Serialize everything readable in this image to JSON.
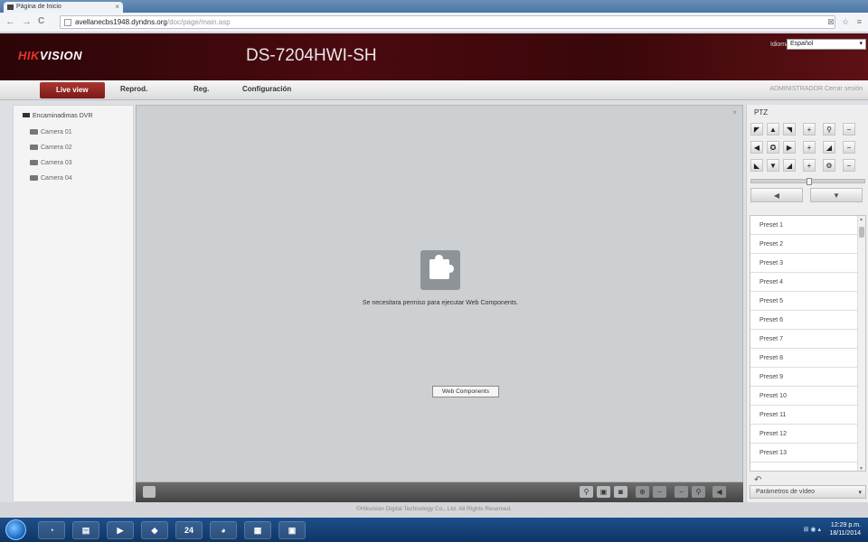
{
  "browser": {
    "tab_title": "Página de Inicio",
    "tab_close": "×",
    "back": "←",
    "forward": "→",
    "reload": "C",
    "url_host": "avellanecbs1948.dyndns.org",
    "url_path": "/doc/page/main.asp",
    "toolbar_right": "⊠ ☆ ≡"
  },
  "header": {
    "logo_prefix": "HIK",
    "logo_suffix": "VISION",
    "device_title": "DS-7204HWI-SH",
    "language_label": "Idioma",
    "language_value": "Español",
    "language_caret": "▾"
  },
  "menu": {
    "items": [
      {
        "label": "Live view",
        "active": true
      },
      {
        "label": "Reprod."
      },
      {
        "label": "Reg."
      },
      {
        "label": "Configuración"
      }
    ],
    "right_text": "ADMINISTRADOR  Cerrar sesión"
  },
  "device_tree": {
    "root": "Encaminadimas DVR",
    "cameras": [
      "Camera 01",
      "Camera 02",
      "Camera 03",
      "Camera 04"
    ]
  },
  "video": {
    "close": "×",
    "plugin_message": "Se necesitara permiso para ejecutar Web Components.",
    "plugin_button": "Web Components"
  },
  "bottom_toolbar": {
    "buttons": [
      "⚲",
      "▣",
      "◙",
      "⊕",
      "−",
      "−",
      "⚲",
      "◀"
    ]
  },
  "ptz": {
    "title": "PTZ",
    "buttons": [
      [
        "◤",
        "▲",
        "◥",
        "+",
        "⚲",
        "−"
      ],
      [
        "◀",
        "✪",
        "▶",
        "+",
        "◢",
        "−"
      ],
      [
        "◣",
        "▼",
        "◢",
        "+",
        "⚙",
        "−"
      ]
    ],
    "left_button": "◀",
    "right_button": "▼",
    "slider_level": 0.5,
    "presets": [
      "Preset 1",
      "Preset 2",
      "Preset 3",
      "Preset 4",
      "Preset 5",
      "Preset 6",
      "Preset 7",
      "Preset 8",
      "Preset 9",
      "Preset 10",
      "Preset 11",
      "Preset 12",
      "Preset 13"
    ],
    "preset_tool": "↶",
    "video_params": "Parámetros de vídeo",
    "video_params_caret": "▾"
  },
  "footer": {
    "text": "©Hikvision Digital Technology Co., Ltd. All Rights Reserved."
  },
  "taskbar": {
    "apps": [
      "◔",
      "▤",
      "▶",
      "◆",
      "24",
      "◕",
      "▦",
      "▣"
    ],
    "tray_icons": "⊞ ◉ ▴",
    "time": "12:29 p.m.",
    "date": "18/11/2014"
  }
}
